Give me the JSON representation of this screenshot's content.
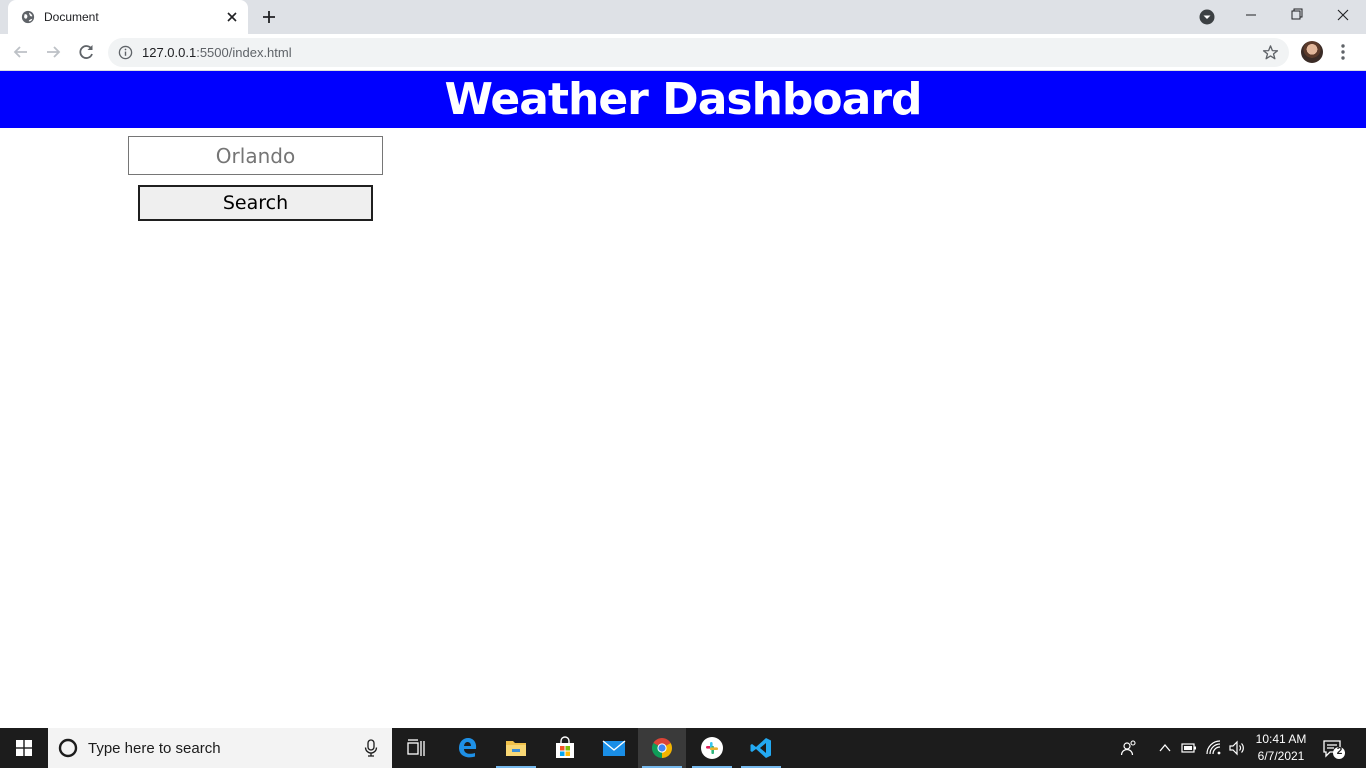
{
  "browser": {
    "tab_title": "Document",
    "url_host": "127.0.0.1",
    "url_rest": ":5500/index.html"
  },
  "page": {
    "title": "Weather Dashboard",
    "city_input_placeholder": "Orlando",
    "search_label": "Search",
    "header_color": "#0000ff"
  },
  "taskbar": {
    "search_placeholder": "Type here to search",
    "time": "10:41 AM",
    "date": "6/7/2021",
    "notification_count": "2",
    "apps": [
      "task-view",
      "edge",
      "file-explorer",
      "microsoft-store",
      "mail",
      "chrome",
      "slack",
      "vscode"
    ]
  }
}
